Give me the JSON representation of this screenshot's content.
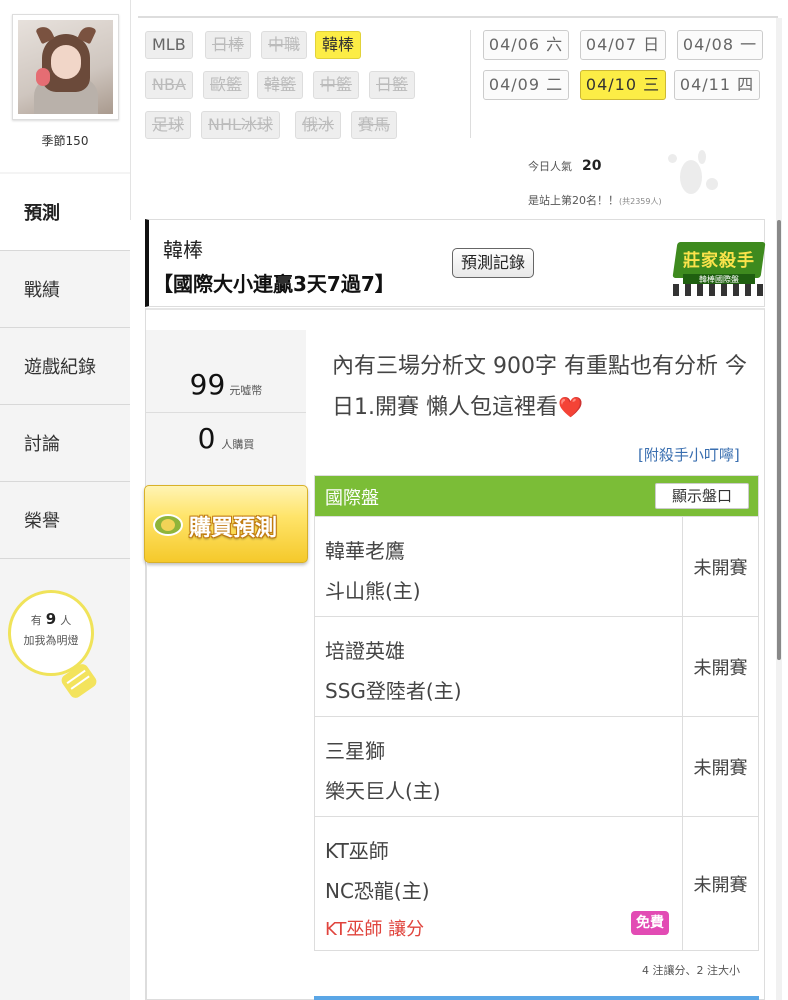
{
  "profile": {
    "nickname": "季節150",
    "avatar_alt": "avatar"
  },
  "sidebar": {
    "items": [
      {
        "label": "預測",
        "active": true
      },
      {
        "label": "戰績",
        "active": false
      },
      {
        "label": "遊戲紀錄",
        "active": false
      },
      {
        "label": "討論",
        "active": false
      },
      {
        "label": "榮譽",
        "active": false
      }
    ],
    "fans": {
      "prefix": "有",
      "count": "9",
      "suffix": "人",
      "caption": "加我為明燈"
    }
  },
  "categories": [
    {
      "label": "MLB",
      "state": "plain"
    },
    {
      "label": "日棒",
      "state": "disabled"
    },
    {
      "label": "中職",
      "state": "disabled"
    },
    {
      "label": "韓棒",
      "state": "selected"
    },
    {
      "label": "NBA",
      "state": "disabled"
    },
    {
      "label": "歐籃",
      "state": "disabled"
    },
    {
      "label": "韓籃",
      "state": "disabled"
    },
    {
      "label": "中籃",
      "state": "disabled"
    },
    {
      "label": "日籃",
      "state": "disabled"
    },
    {
      "label": "足球",
      "state": "disabled"
    },
    {
      "label": "NHL冰球",
      "state": "disabled"
    },
    {
      "label": "俄冰",
      "state": "disabled"
    },
    {
      "label": "賽馬",
      "state": "disabled"
    }
  ],
  "dates": [
    {
      "label": "04/06 六",
      "selected": false
    },
    {
      "label": "04/07 日",
      "selected": false
    },
    {
      "label": "04/08 一",
      "selected": false
    },
    {
      "label": "04/09 二",
      "selected": false
    },
    {
      "label": "04/10 三",
      "selected": true
    },
    {
      "label": "04/11 四",
      "selected": false
    }
  ],
  "popularity": {
    "label": "今日人氣",
    "value": "20",
    "rank_text": "是站上第20名！！",
    "rank_note": "(共2359人)"
  },
  "prediction": {
    "category": "韓棒",
    "title": "【國際大小連贏3天7過7】",
    "record_button": "預測記錄",
    "badge": {
      "main": "莊家殺手",
      "sub": "韓棒國際盤"
    }
  },
  "purchase": {
    "price": "99",
    "price_unit": "元噓幣",
    "buyers": "0",
    "buyers_unit": "人購買",
    "buy_button": "購買預測"
  },
  "description": {
    "text": "內有三場分析文 900字 有重點也有分析 今日1.開賽 懶人包這裡看",
    "emoji": "❤️"
  },
  "tip_link": "[附殺手小叮嚀]",
  "games_table": {
    "header": "國際盤",
    "show_button": "顯示盤口",
    "rows": [
      {
        "away": "韓華老鷹",
        "home": "斗山熊(主)",
        "status": "未開賽"
      },
      {
        "away": "培證英雄",
        "home": "SSG登陸者(主)",
        "status": "未開賽"
      },
      {
        "away": "三星獅",
        "home": "樂天巨人(主)",
        "status": "未開賽"
      },
      {
        "away": "KT巫師",
        "home": "NC恐龍(主)",
        "status": "未開賽",
        "pick": "KT巫師 讓分",
        "pick_tag": "免費"
      }
    ],
    "summary": "4 注讓分、2 注大小"
  },
  "colors": {
    "selected_yellow": "#fced46",
    "table_header_green": "#7bbd37",
    "link_blue": "#3a6fb0",
    "pick_red": "#e0443d",
    "free_pink": "#e24bb4"
  }
}
